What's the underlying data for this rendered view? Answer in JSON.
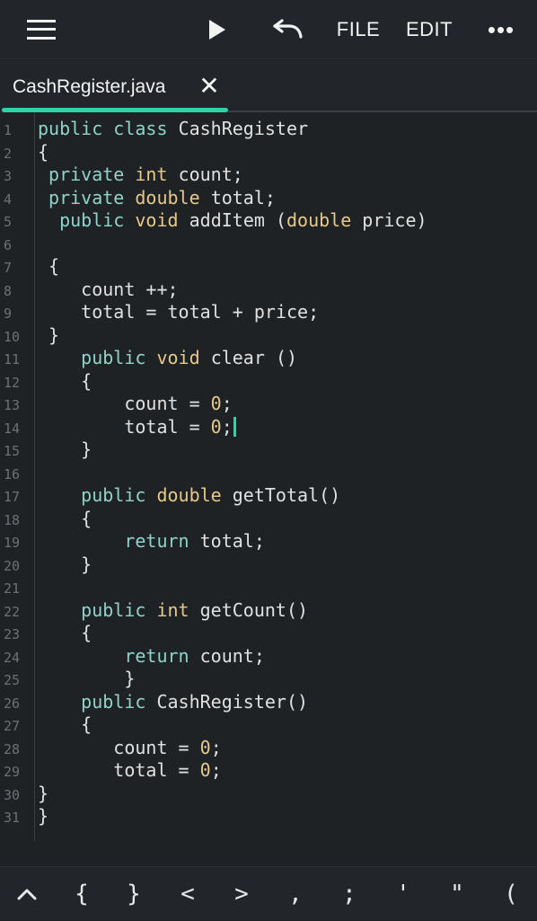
{
  "toolbar": {
    "file_label": "FILE",
    "edit_label": "EDIT",
    "more_label": "•••"
  },
  "tab": {
    "filename": "CashRegister.java",
    "close_glyph": "✕"
  },
  "editor": {
    "line_numbers": [
      "1",
      "2",
      "3",
      "4",
      "5",
      "6",
      "7",
      "8",
      "9",
      "10",
      "11",
      "12",
      "13",
      "14",
      "15",
      "16",
      "17",
      "18",
      "19",
      "20",
      "21",
      "22",
      "23",
      "24",
      "25",
      "26",
      "27",
      "28",
      "29",
      "30",
      "31"
    ],
    "lines": [
      "public class CashRegister",
      "{",
      " private int count;",
      " private double total;",
      "  public void addItem (double price)",
      "",
      " {",
      "    count ++;",
      "    total = total + price;",
      " }",
      "    public void clear ()",
      "    {",
      "        count = 0;",
      "        total = 0;",
      "    }",
      "",
      "    public double getTotal()",
      "    {",
      "        return total;",
      "    }",
      "",
      "    public int getCount()",
      "    {",
      "        return count;",
      "        }",
      "    public CashRegister()",
      "    {",
      "       count = 0;",
      "       total = 0;",
      "}",
      "}"
    ],
    "cursor_line": 14
  },
  "keybar": {
    "keys": [
      "^",
      "{",
      "}",
      "<",
      ">",
      ",",
      ";",
      "'",
      "\"",
      "("
    ]
  },
  "colors": {
    "accent": "#2fd4a4",
    "keyword": "#8fd3c8",
    "type": "#e6c98a",
    "background": "#1f2225"
  }
}
